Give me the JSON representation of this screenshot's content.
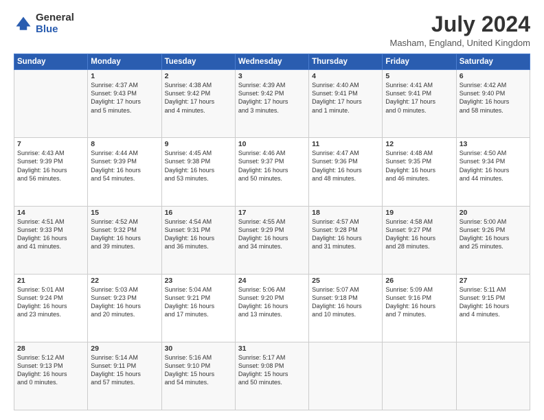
{
  "logo": {
    "general": "General",
    "blue": "Blue"
  },
  "header": {
    "title": "July 2024",
    "subtitle": "Masham, England, United Kingdom"
  },
  "columns": [
    "Sunday",
    "Monday",
    "Tuesday",
    "Wednesday",
    "Thursday",
    "Friday",
    "Saturday"
  ],
  "weeks": [
    [
      {
        "day": "",
        "text": ""
      },
      {
        "day": "1",
        "text": "Sunrise: 4:37 AM\nSunset: 9:43 PM\nDaylight: 17 hours\nand 5 minutes."
      },
      {
        "day": "2",
        "text": "Sunrise: 4:38 AM\nSunset: 9:42 PM\nDaylight: 17 hours\nand 4 minutes."
      },
      {
        "day": "3",
        "text": "Sunrise: 4:39 AM\nSunset: 9:42 PM\nDaylight: 17 hours\nand 3 minutes."
      },
      {
        "day": "4",
        "text": "Sunrise: 4:40 AM\nSunset: 9:41 PM\nDaylight: 17 hours\nand 1 minute."
      },
      {
        "day": "5",
        "text": "Sunrise: 4:41 AM\nSunset: 9:41 PM\nDaylight: 17 hours\nand 0 minutes."
      },
      {
        "day": "6",
        "text": "Sunrise: 4:42 AM\nSunset: 9:40 PM\nDaylight: 16 hours\nand 58 minutes."
      }
    ],
    [
      {
        "day": "7",
        "text": "Sunrise: 4:43 AM\nSunset: 9:39 PM\nDaylight: 16 hours\nand 56 minutes."
      },
      {
        "day": "8",
        "text": "Sunrise: 4:44 AM\nSunset: 9:39 PM\nDaylight: 16 hours\nand 54 minutes."
      },
      {
        "day": "9",
        "text": "Sunrise: 4:45 AM\nSunset: 9:38 PM\nDaylight: 16 hours\nand 53 minutes."
      },
      {
        "day": "10",
        "text": "Sunrise: 4:46 AM\nSunset: 9:37 PM\nDaylight: 16 hours\nand 50 minutes."
      },
      {
        "day": "11",
        "text": "Sunrise: 4:47 AM\nSunset: 9:36 PM\nDaylight: 16 hours\nand 48 minutes."
      },
      {
        "day": "12",
        "text": "Sunrise: 4:48 AM\nSunset: 9:35 PM\nDaylight: 16 hours\nand 46 minutes."
      },
      {
        "day": "13",
        "text": "Sunrise: 4:50 AM\nSunset: 9:34 PM\nDaylight: 16 hours\nand 44 minutes."
      }
    ],
    [
      {
        "day": "14",
        "text": "Sunrise: 4:51 AM\nSunset: 9:33 PM\nDaylight: 16 hours\nand 41 minutes."
      },
      {
        "day": "15",
        "text": "Sunrise: 4:52 AM\nSunset: 9:32 PM\nDaylight: 16 hours\nand 39 minutes."
      },
      {
        "day": "16",
        "text": "Sunrise: 4:54 AM\nSunset: 9:31 PM\nDaylight: 16 hours\nand 36 minutes."
      },
      {
        "day": "17",
        "text": "Sunrise: 4:55 AM\nSunset: 9:29 PM\nDaylight: 16 hours\nand 34 minutes."
      },
      {
        "day": "18",
        "text": "Sunrise: 4:57 AM\nSunset: 9:28 PM\nDaylight: 16 hours\nand 31 minutes."
      },
      {
        "day": "19",
        "text": "Sunrise: 4:58 AM\nSunset: 9:27 PM\nDaylight: 16 hours\nand 28 minutes."
      },
      {
        "day": "20",
        "text": "Sunrise: 5:00 AM\nSunset: 9:26 PM\nDaylight: 16 hours\nand 25 minutes."
      }
    ],
    [
      {
        "day": "21",
        "text": "Sunrise: 5:01 AM\nSunset: 9:24 PM\nDaylight: 16 hours\nand 23 minutes."
      },
      {
        "day": "22",
        "text": "Sunrise: 5:03 AM\nSunset: 9:23 PM\nDaylight: 16 hours\nand 20 minutes."
      },
      {
        "day": "23",
        "text": "Sunrise: 5:04 AM\nSunset: 9:21 PM\nDaylight: 16 hours\nand 17 minutes."
      },
      {
        "day": "24",
        "text": "Sunrise: 5:06 AM\nSunset: 9:20 PM\nDaylight: 16 hours\nand 13 minutes."
      },
      {
        "day": "25",
        "text": "Sunrise: 5:07 AM\nSunset: 9:18 PM\nDaylight: 16 hours\nand 10 minutes."
      },
      {
        "day": "26",
        "text": "Sunrise: 5:09 AM\nSunset: 9:16 PM\nDaylight: 16 hours\nand 7 minutes."
      },
      {
        "day": "27",
        "text": "Sunrise: 5:11 AM\nSunset: 9:15 PM\nDaylight: 16 hours\nand 4 minutes."
      }
    ],
    [
      {
        "day": "28",
        "text": "Sunrise: 5:12 AM\nSunset: 9:13 PM\nDaylight: 16 hours\nand 0 minutes."
      },
      {
        "day": "29",
        "text": "Sunrise: 5:14 AM\nSunset: 9:11 PM\nDaylight: 15 hours\nand 57 minutes."
      },
      {
        "day": "30",
        "text": "Sunrise: 5:16 AM\nSunset: 9:10 PM\nDaylight: 15 hours\nand 54 minutes."
      },
      {
        "day": "31",
        "text": "Sunrise: 5:17 AM\nSunset: 9:08 PM\nDaylight: 15 hours\nand 50 minutes."
      },
      {
        "day": "",
        "text": ""
      },
      {
        "day": "",
        "text": ""
      },
      {
        "day": "",
        "text": ""
      }
    ]
  ]
}
